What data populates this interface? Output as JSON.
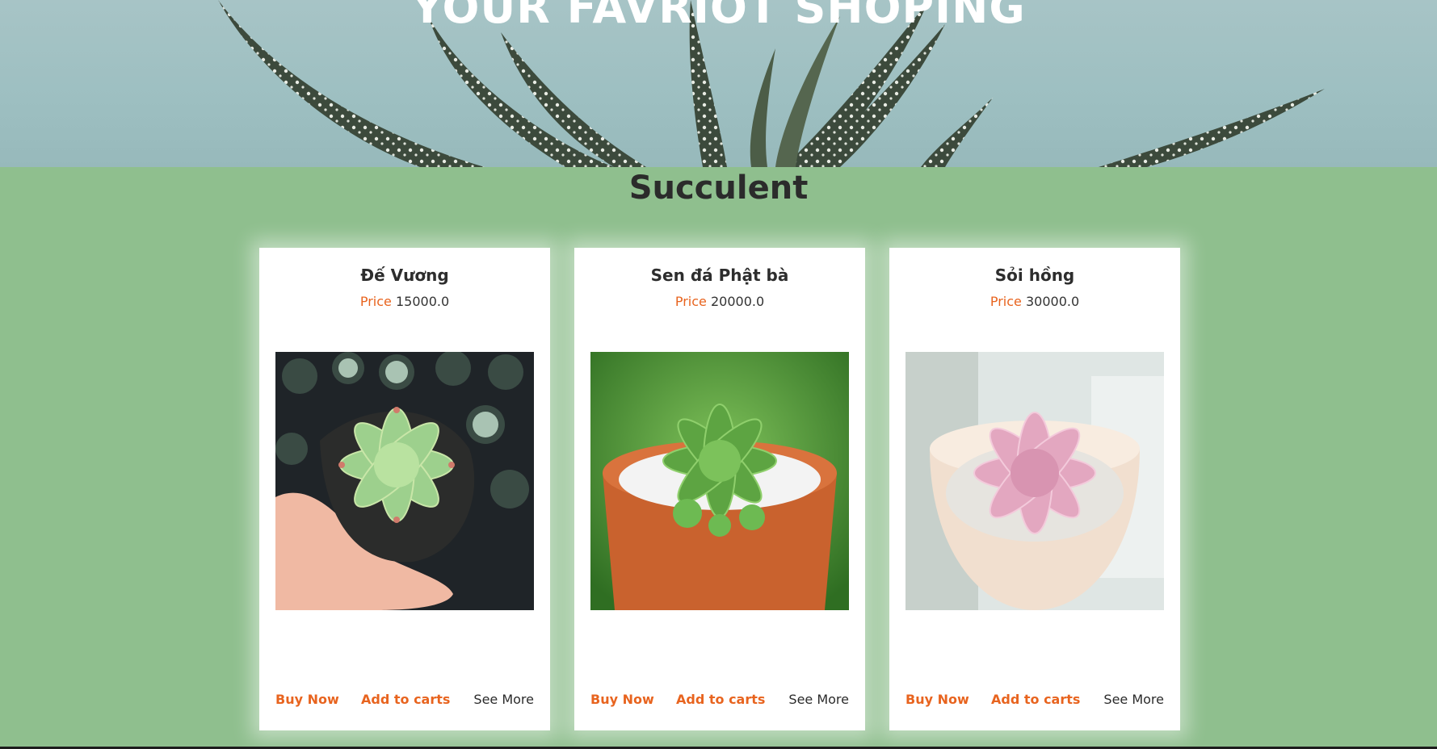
{
  "hero": {
    "title": "YOUR FAVRIOT SHOPING"
  },
  "section": {
    "title": "Succulent"
  },
  "products": [
    {
      "name": "Đế Vương",
      "price_label": "Price",
      "price": "15000.0",
      "buy": "Buy Now",
      "cart": "Add to carts",
      "more": "See More"
    },
    {
      "name": "Sen đá Phật bà",
      "price_label": "Price",
      "price": "20000.0",
      "buy": "Buy Now",
      "cart": "Add to carts",
      "more": "See More"
    },
    {
      "name": "Sỏi hồng",
      "price_label": "Price",
      "price": "30000.0",
      "buy": "Buy Now",
      "cart": "Add to carts",
      "more": "See More"
    }
  ],
  "colors": {
    "background": "#8fbf8e",
    "accent": "#e8641f",
    "text": "#2b2b2b",
    "card": "#ffffff"
  }
}
